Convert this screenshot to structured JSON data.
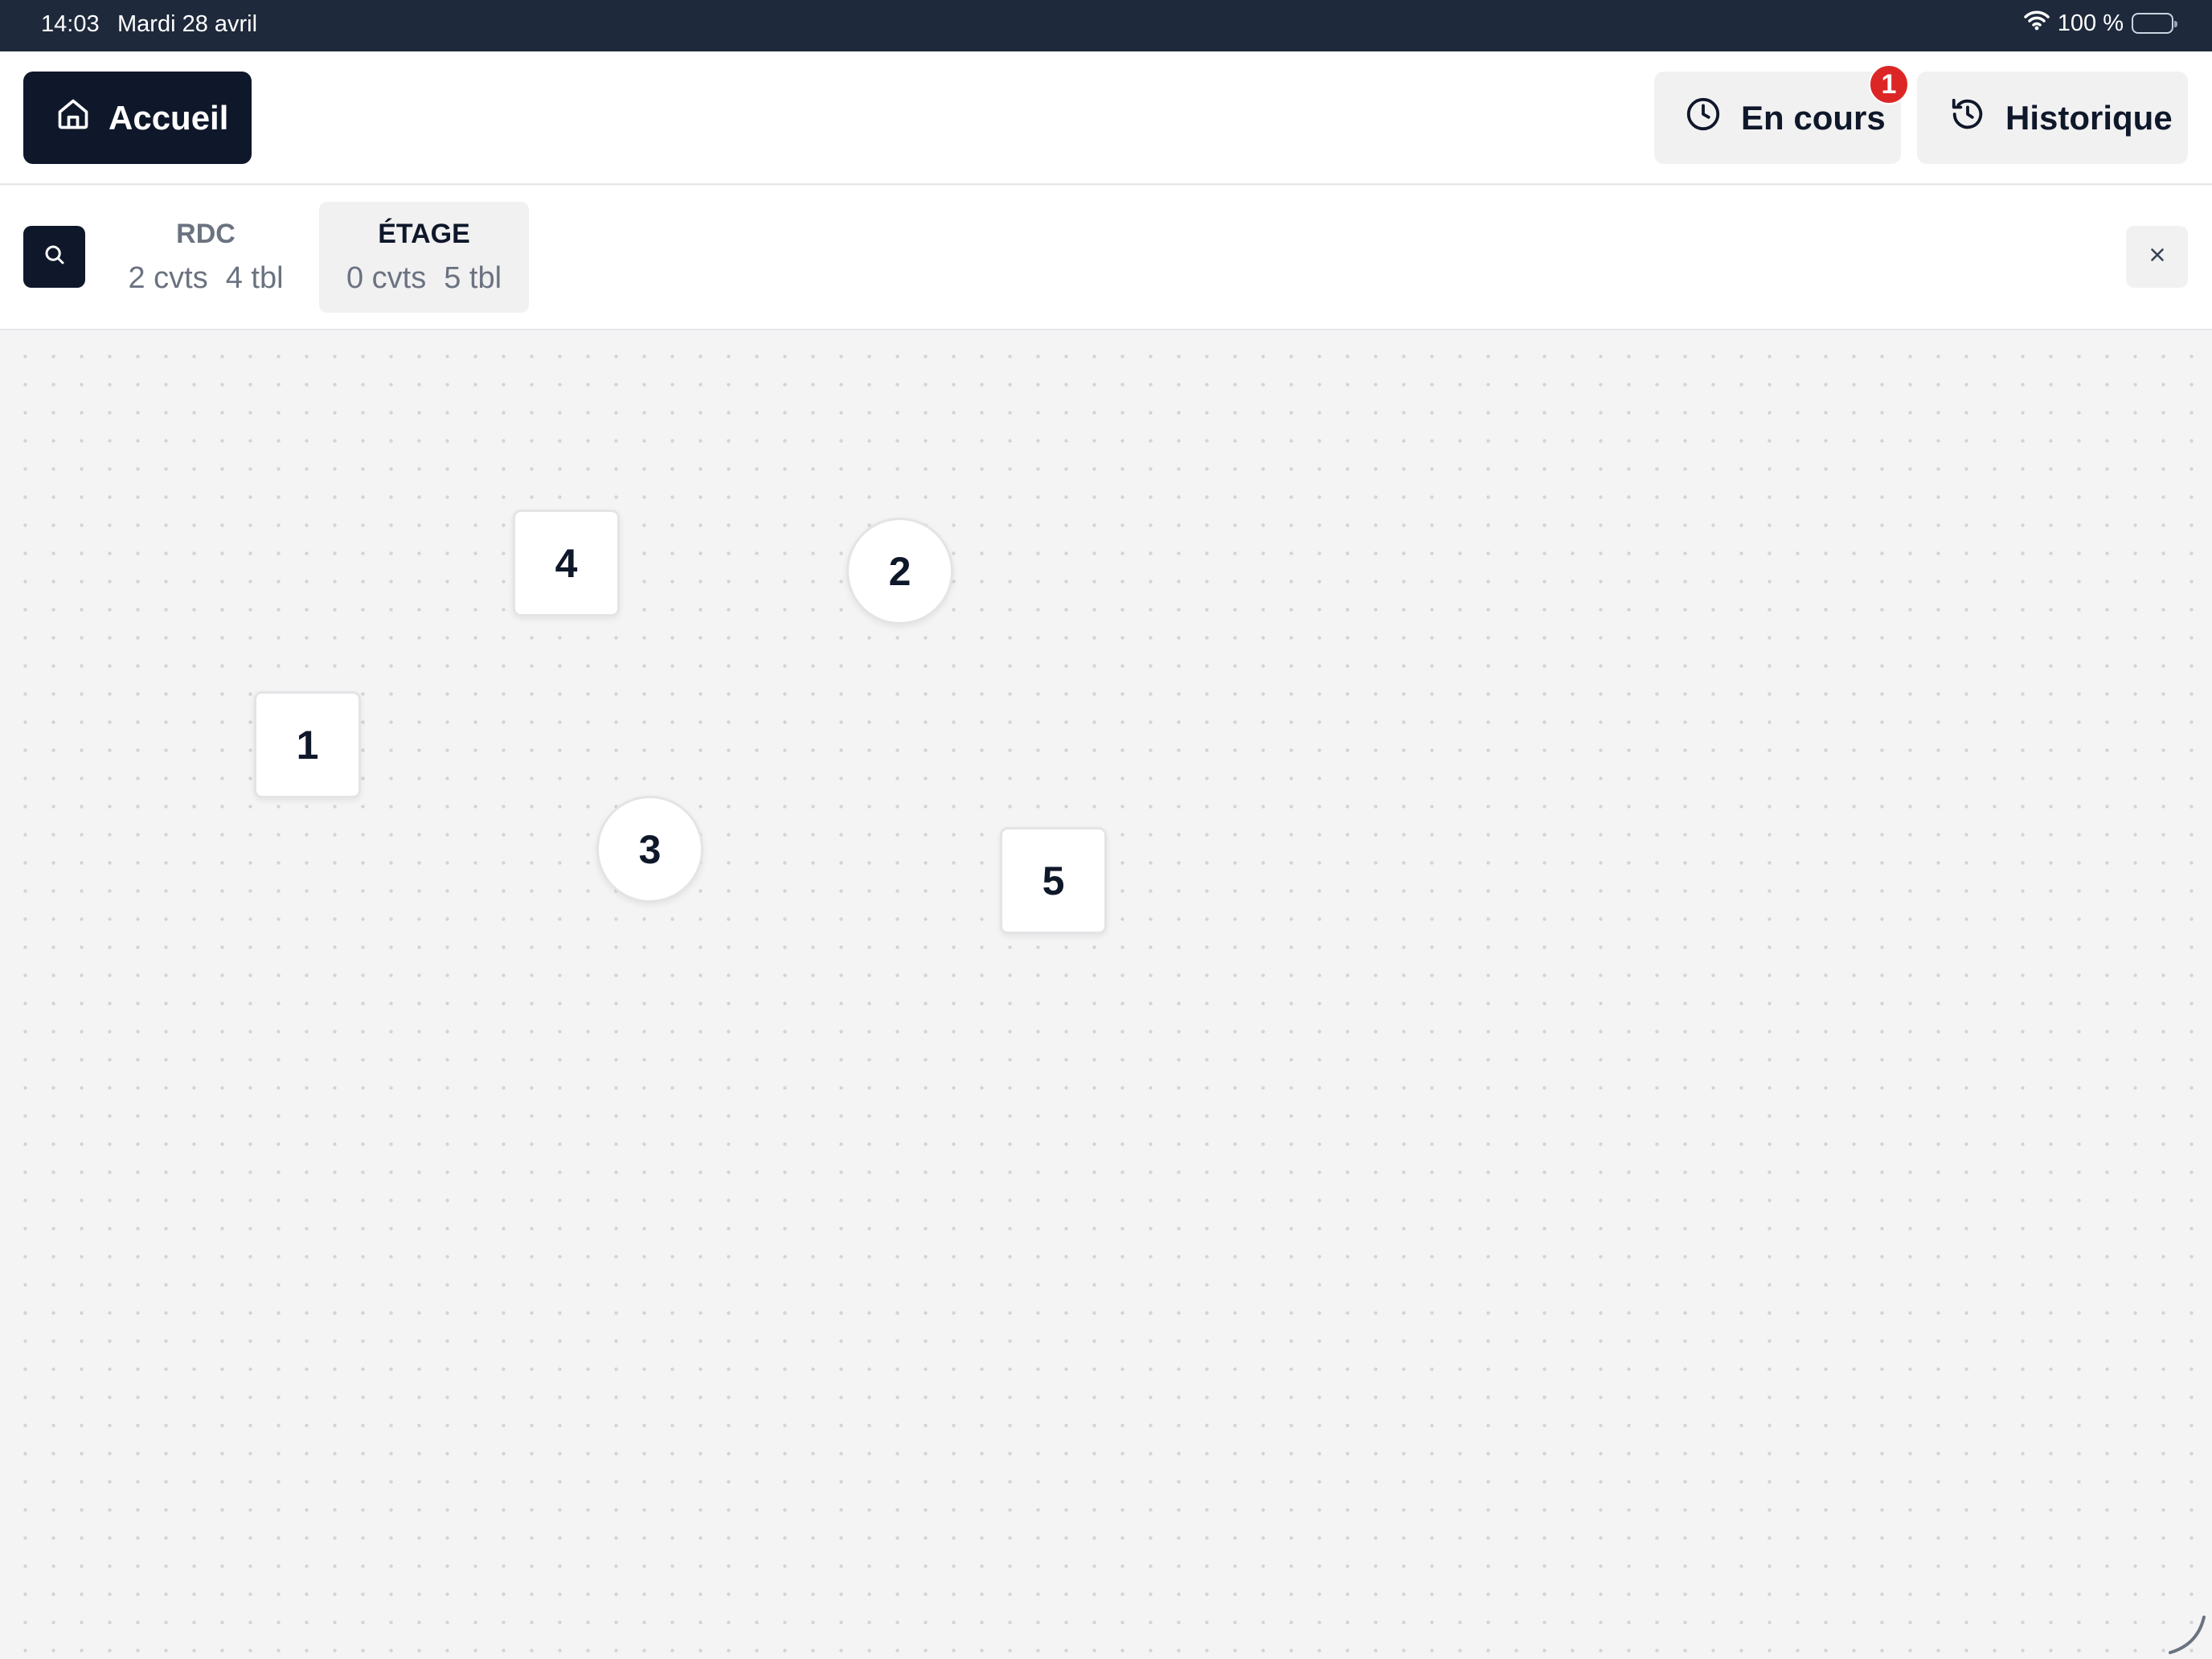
{
  "status_bar": {
    "time": "14:03",
    "date": "Mardi 28 avril",
    "battery": "100 %"
  },
  "header": {
    "home_label": "Accueil",
    "en_cours_label": "En cours",
    "en_cours_badge": "1",
    "historique_label": "Historique"
  },
  "floors": [
    {
      "name": "RDC",
      "covers": "2 cvts",
      "tables": "4 tbl",
      "selected": false
    },
    {
      "name": "ÉTAGE",
      "covers": "0 cvts",
      "tables": "5 tbl",
      "selected": true
    }
  ],
  "tables": [
    {
      "number": "4",
      "shape": "square"
    },
    {
      "number": "2",
      "shape": "round"
    },
    {
      "number": "1",
      "shape": "square"
    },
    {
      "number": "3",
      "shape": "round"
    },
    {
      "number": "5",
      "shape": "square"
    }
  ],
  "colors": {
    "primary": "#0f172a",
    "status_bar": "#1e293b",
    "badge": "#dc2626",
    "canvas_bg": "#f4f4f5",
    "secondary_button": "#f1f1f2"
  },
  "icons": {
    "home": "home-icon",
    "clock": "clock-icon",
    "history": "history-icon",
    "search": "search-icon",
    "close": "close-icon",
    "wifi": "wifi-icon",
    "battery": "battery-icon"
  }
}
